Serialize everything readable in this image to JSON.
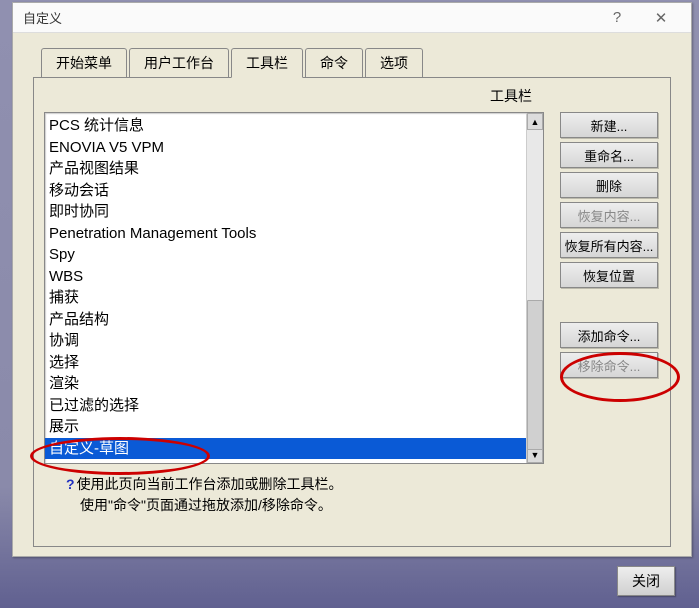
{
  "dialog": {
    "title": "自定义",
    "help_btn": "?",
    "close_x": "✕"
  },
  "tabs": {
    "items": [
      {
        "label": "开始菜单"
      },
      {
        "label": "用户工作台"
      },
      {
        "label": "工具栏"
      },
      {
        "label": "命令"
      },
      {
        "label": "选项"
      }
    ],
    "active_index": 2
  },
  "section_label": "工具栏",
  "listbox": {
    "items": [
      "PCS 统计信息",
      "ENOVIA V5 VPM",
      "产品视图结果",
      "移动会话",
      "即时协同",
      "Penetration Management Tools",
      "Spy",
      "WBS",
      "捕获",
      "产品结构",
      "协调",
      "选择",
      "渲染",
      "已过滤的选择",
      "展示",
      "自定义-草图"
    ],
    "selected_index": 15
  },
  "buttons": {
    "new": "新建...",
    "rename": "重命名...",
    "delete": "删除",
    "restore_content": "恢复内容...",
    "restore_all": "恢复所有内容...",
    "restore_pos": "恢复位置",
    "add_cmd": "添加命令...",
    "remove_cmd": "移除命令..."
  },
  "help": {
    "line1": "使用此页向当前工作台添加或删除工具栏。",
    "line2": "使用\"命令\"页面通过拖放添加/移除命令。"
  },
  "bottom_close": "关闭"
}
